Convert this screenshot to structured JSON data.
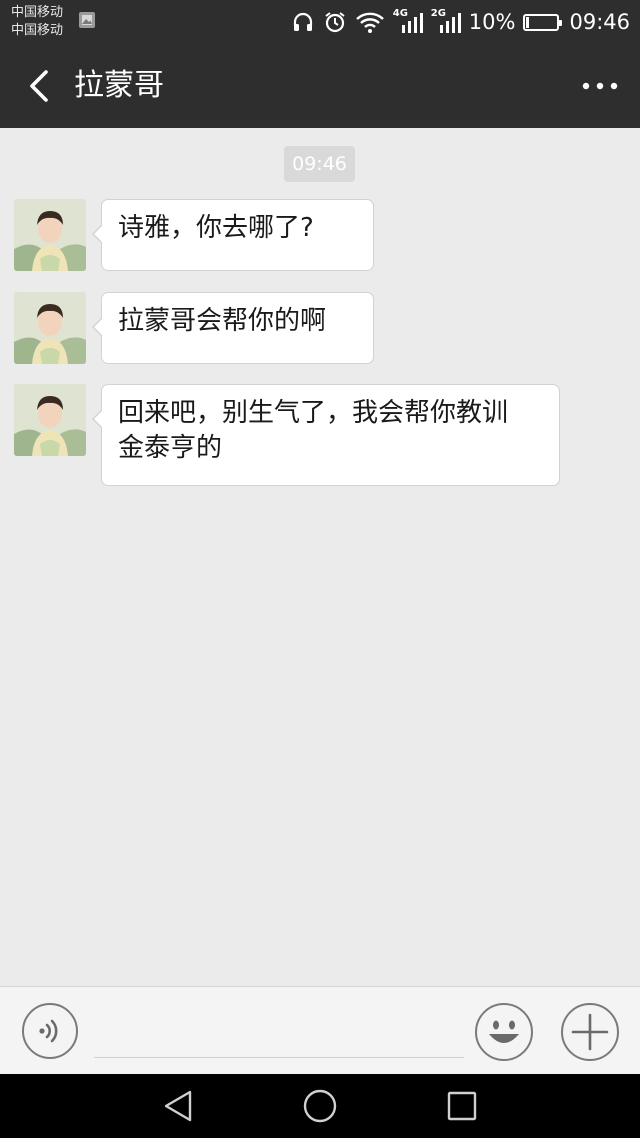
{
  "status_bar": {
    "carrier_1": "中国移动",
    "carrier_2": "中国移动",
    "net_1": "4G",
    "net_2": "2G",
    "battery_percent": "10%",
    "battery_level": 0.1,
    "time": "09:46",
    "icons": [
      "gallery-icon",
      "headphones-icon",
      "alarm-icon",
      "wifi-icon",
      "signal-icon",
      "signal-icon",
      "battery-icon"
    ]
  },
  "header": {
    "title": "拉蒙哥",
    "back_icon": "chevron-left-icon",
    "more_icon": "more-dots-icon"
  },
  "chat": {
    "timestamp": "09:46",
    "messages": [
      {
        "sender": "拉蒙哥",
        "line1": "诗雅，你去哪了?",
        "line2": ""
      },
      {
        "sender": "拉蒙哥",
        "line1": "拉蒙哥会帮你的啊",
        "line2": ""
      },
      {
        "sender": "拉蒙哥",
        "line1": "回来吧，别生气了，我会帮你教训",
        "line2": "金泰亨的"
      }
    ]
  },
  "input_bar": {
    "value": "",
    "placeholder": "",
    "voice_icon": "voice-icon",
    "emoji_icon": "emoji-icon",
    "plus_icon": "plus-icon"
  },
  "nav_bar": {
    "icons": [
      "nav-back-icon",
      "nav-home-icon",
      "nav-recents-icon"
    ]
  },
  "colors": {
    "bar_background": "#2e2e2e",
    "chat_background": "#ebebeb",
    "bubble": "#ffffff",
    "timestamp_pill": "#d9d9d9"
  }
}
